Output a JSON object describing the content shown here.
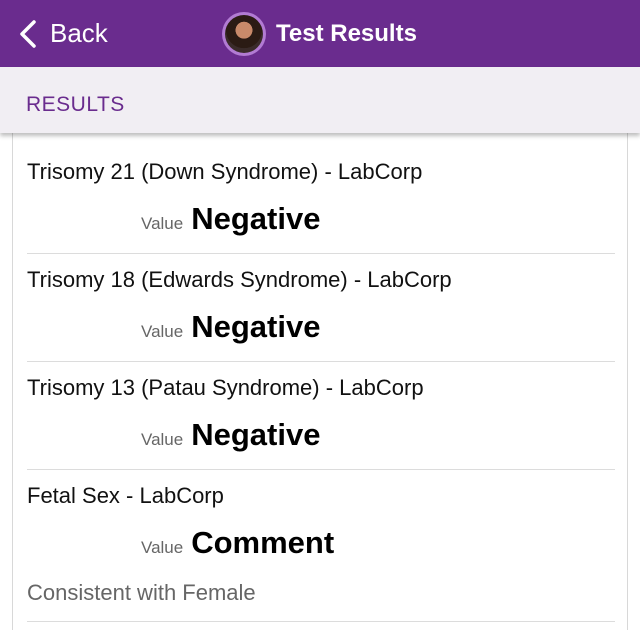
{
  "navbar": {
    "back_label": "Back",
    "title": "Test Results",
    "background_color": "#6a2c8e"
  },
  "section": {
    "title": "RESULTS"
  },
  "results": [
    {
      "name": "Trisomy 21 (Down Syndrome) - LabCorp",
      "value_label": "Value",
      "value": "Negative"
    },
    {
      "name": "Trisomy 18 (Edwards Syndrome) - LabCorp",
      "value_label": "Value",
      "value": "Negative"
    },
    {
      "name": "Trisomy 13 (Patau Syndrome) - LabCorp",
      "value_label": "Value",
      "value": "Negative"
    },
    {
      "name": "Fetal Sex - LabCorp",
      "value_label": "Value",
      "value": "Comment",
      "comment": "Consistent with Female"
    }
  ]
}
